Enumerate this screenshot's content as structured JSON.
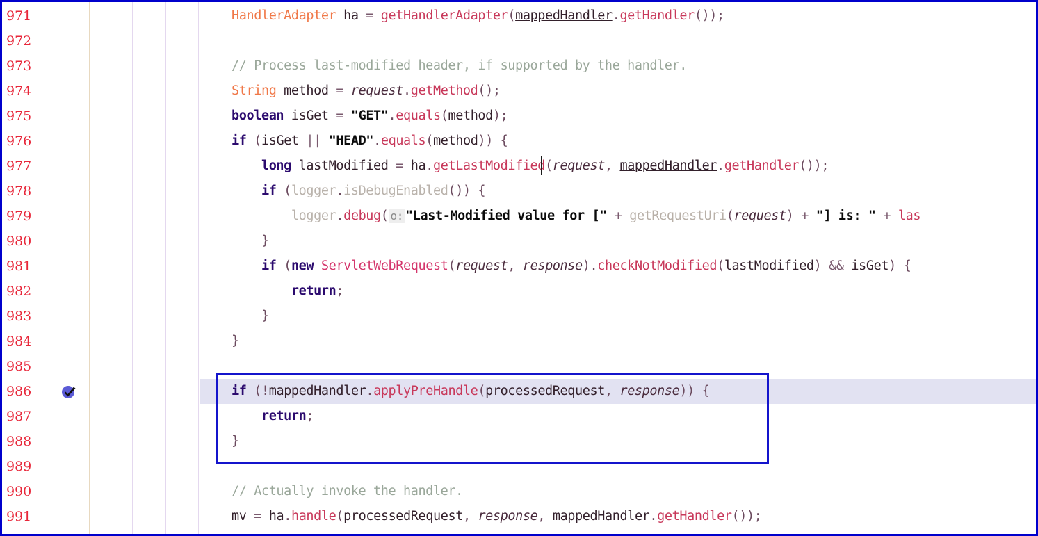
{
  "app": {
    "kind": "code-editor",
    "language": "java",
    "accent_color": "#1414cc",
    "linenumber_color": "#e8273a",
    "exec_highlight_color": "#e2e2f2"
  },
  "gutter": {
    "line_numbers": [
      "971",
      "972",
      "973",
      "974",
      "975",
      "976",
      "977",
      "978",
      "979",
      "980",
      "981",
      "982",
      "983",
      "984",
      "985",
      "986",
      "987",
      "988",
      "989",
      "990",
      "991"
    ],
    "breakpoint": {
      "icon": "breakpoint-verified-icon",
      "on_line": "986",
      "fill_color": "#5b5bd6",
      "check_color": "#111111"
    }
  },
  "selection": {
    "label": "code-selection-rectangle",
    "border_color": "#1414cc",
    "start_line": "986",
    "end_line": "988"
  },
  "caret": {
    "line": "977",
    "after_text": "getLastModifi"
  },
  "inline_hints": [
    {
      "line": "979",
      "text": "o:"
    }
  ],
  "code": {
    "lines": [
      {
        "num": "971",
        "tokens": [
          {
            "t": "type",
            "v": "HandlerAdapter"
          },
          {
            "t": "plain",
            "v": " ha "
          },
          {
            "t": "op",
            "v": "="
          },
          {
            "t": "plain",
            "v": " "
          },
          {
            "t": "mth",
            "v": "getHandlerAdapter"
          },
          {
            "t": "punc",
            "v": "("
          },
          {
            "t": "fld",
            "v": "mappedHandler"
          },
          {
            "t": "punc",
            "v": "."
          },
          {
            "t": "mth",
            "v": "getHandler"
          },
          {
            "t": "punc",
            "v": "());"
          }
        ]
      },
      {
        "num": "972",
        "tokens": []
      },
      {
        "num": "973",
        "tokens": [
          {
            "t": "cmt",
            "v": "// Process last-modified header, if supported by the handler."
          }
        ]
      },
      {
        "num": "974",
        "tokens": [
          {
            "t": "type",
            "v": "String"
          },
          {
            "t": "plain",
            "v": " method "
          },
          {
            "t": "op",
            "v": "="
          },
          {
            "t": "plain",
            "v": " "
          },
          {
            "t": "parm",
            "v": "request"
          },
          {
            "t": "punc",
            "v": "."
          },
          {
            "t": "mth",
            "v": "getMethod"
          },
          {
            "t": "punc",
            "v": "();"
          }
        ]
      },
      {
        "num": "975",
        "tokens": [
          {
            "t": "kw",
            "v": "boolean"
          },
          {
            "t": "plain",
            "v": " isGet "
          },
          {
            "t": "op",
            "v": "="
          },
          {
            "t": "plain",
            "v": " "
          },
          {
            "t": "str",
            "v": "\"GET\""
          },
          {
            "t": "punc",
            "v": "."
          },
          {
            "t": "mth",
            "v": "equals"
          },
          {
            "t": "punc",
            "v": "("
          },
          {
            "t": "plain",
            "v": "method"
          },
          {
            "t": "punc",
            "v": ");"
          }
        ]
      },
      {
        "num": "976",
        "tokens": [
          {
            "t": "kw",
            "v": "if"
          },
          {
            "t": "plain",
            "v": " "
          },
          {
            "t": "punc",
            "v": "("
          },
          {
            "t": "plain",
            "v": "isGet "
          },
          {
            "t": "op",
            "v": "||"
          },
          {
            "t": "plain",
            "v": " "
          },
          {
            "t": "str",
            "v": "\"HEAD\""
          },
          {
            "t": "punc",
            "v": "."
          },
          {
            "t": "mth",
            "v": "equals"
          },
          {
            "t": "punc",
            "v": "("
          },
          {
            "t": "plain",
            "v": "method"
          },
          {
            "t": "punc",
            "v": ")) {"
          }
        ]
      },
      {
        "num": "977",
        "indent": 1,
        "tokens": [
          {
            "t": "kw",
            "v": "long"
          },
          {
            "t": "plain",
            "v": " lastModified "
          },
          {
            "t": "op",
            "v": "="
          },
          {
            "t": "plain",
            "v": " ha"
          },
          {
            "t": "punc",
            "v": "."
          },
          {
            "t": "mth",
            "v": "getLastModified"
          },
          {
            "t": "punc",
            "v": "("
          },
          {
            "t": "parm",
            "v": "request"
          },
          {
            "t": "punc",
            "v": ", "
          },
          {
            "t": "fld",
            "v": "mappedHandler"
          },
          {
            "t": "punc",
            "v": "."
          },
          {
            "t": "mth",
            "v": "getHandler"
          },
          {
            "t": "punc",
            "v": "());"
          }
        ]
      },
      {
        "num": "978",
        "indent": 1,
        "tokens": [
          {
            "t": "kw",
            "v": "if"
          },
          {
            "t": "plain",
            "v": " "
          },
          {
            "t": "punc",
            "v": "("
          },
          {
            "t": "dim",
            "v": "logger"
          },
          {
            "t": "punc",
            "v": "."
          },
          {
            "t": "dim",
            "v": "isDebugEnabled"
          },
          {
            "t": "punc",
            "v": "()) {"
          }
        ]
      },
      {
        "num": "979",
        "indent": 2,
        "tokens": [
          {
            "t": "dim",
            "v": "logger"
          },
          {
            "t": "punc",
            "v": "."
          },
          {
            "t": "mth",
            "v": "debug"
          },
          {
            "t": "punc",
            "v": "("
          },
          {
            "t": "hint",
            "v": "o:"
          },
          {
            "t": "str",
            "v": "\"Last-Modified value for [\""
          },
          {
            "t": "plain",
            "v": " "
          },
          {
            "t": "op",
            "v": "+"
          },
          {
            "t": "plain",
            "v": " "
          },
          {
            "t": "mth-d",
            "v": "getRequestUri"
          },
          {
            "t": "punc",
            "v": "("
          },
          {
            "t": "parm",
            "v": "request"
          },
          {
            "t": "punc",
            "v": ")"
          },
          {
            "t": "plain",
            "v": " "
          },
          {
            "t": "op",
            "v": "+"
          },
          {
            "t": "plain",
            "v": " "
          },
          {
            "t": "str",
            "v": "\"] is: \""
          },
          {
            "t": "plain",
            "v": " "
          },
          {
            "t": "op",
            "v": "+"
          },
          {
            "t": "plain",
            "v": " "
          },
          {
            "t": "mth",
            "v": "las"
          }
        ]
      },
      {
        "num": "980",
        "indent": 1,
        "tokens": [
          {
            "t": "punc",
            "v": "}"
          }
        ]
      },
      {
        "num": "981",
        "indent": 1,
        "tokens": [
          {
            "t": "kw",
            "v": "if"
          },
          {
            "t": "plain",
            "v": " "
          },
          {
            "t": "punc",
            "v": "("
          },
          {
            "t": "kw",
            "v": "new"
          },
          {
            "t": "plain",
            "v": " "
          },
          {
            "t": "cls",
            "v": "ServletWebRequest"
          },
          {
            "t": "punc",
            "v": "("
          },
          {
            "t": "parm",
            "v": "request"
          },
          {
            "t": "punc",
            "v": ", "
          },
          {
            "t": "parm",
            "v": "response"
          },
          {
            "t": "punc",
            "v": ")."
          },
          {
            "t": "mth",
            "v": "checkNotModified"
          },
          {
            "t": "punc",
            "v": "("
          },
          {
            "t": "plain",
            "v": "lastModified"
          },
          {
            "t": "punc",
            "v": ")"
          },
          {
            "t": "plain",
            "v": " "
          },
          {
            "t": "op",
            "v": "&&"
          },
          {
            "t": "plain",
            "v": " isGet"
          },
          {
            "t": "punc",
            "v": ") {"
          }
        ]
      },
      {
        "num": "982",
        "indent": 2,
        "tokens": [
          {
            "t": "kw",
            "v": "return"
          },
          {
            "t": "punc",
            "v": ";"
          }
        ]
      },
      {
        "num": "983",
        "indent": 1,
        "tokens": [
          {
            "t": "punc",
            "v": "}"
          }
        ]
      },
      {
        "num": "984",
        "tokens": [
          {
            "t": "punc",
            "v": "}"
          }
        ]
      },
      {
        "num": "985",
        "tokens": []
      },
      {
        "num": "986",
        "tokens": [
          {
            "t": "kw",
            "v": "if"
          },
          {
            "t": "plain",
            "v": " "
          },
          {
            "t": "punc",
            "v": "(!"
          },
          {
            "t": "fld",
            "v": "mappedHandler"
          },
          {
            "t": "punc",
            "v": "."
          },
          {
            "t": "mth",
            "v": "applyPreHandle"
          },
          {
            "t": "punc",
            "v": "("
          },
          {
            "t": "parm-u",
            "v": "processedRequest"
          },
          {
            "t": "punc",
            "v": ", "
          },
          {
            "t": "parm",
            "v": "response"
          },
          {
            "t": "punc",
            "v": ")) {"
          }
        ]
      },
      {
        "num": "987",
        "indent": 1,
        "tokens": [
          {
            "t": "kw",
            "v": "return"
          },
          {
            "t": "punc",
            "v": ";"
          }
        ]
      },
      {
        "num": "988",
        "tokens": [
          {
            "t": "punc",
            "v": "}"
          }
        ]
      },
      {
        "num": "989",
        "tokens": []
      },
      {
        "num": "990",
        "tokens": [
          {
            "t": "cmt",
            "v": "// Actually invoke the handler."
          }
        ]
      },
      {
        "num": "991",
        "tokens": [
          {
            "t": "fld",
            "v": "mv"
          },
          {
            "t": "plain",
            "v": " "
          },
          {
            "t": "op",
            "v": "="
          },
          {
            "t": "plain",
            "v": " ha"
          },
          {
            "t": "punc",
            "v": "."
          },
          {
            "t": "mth",
            "v": "handle"
          },
          {
            "t": "punc",
            "v": "("
          },
          {
            "t": "parm-u",
            "v": "processedRequest"
          },
          {
            "t": "punc",
            "v": ", "
          },
          {
            "t": "parm",
            "v": "response"
          },
          {
            "t": "punc",
            "v": ", "
          },
          {
            "t": "fld",
            "v": "mappedHandler"
          },
          {
            "t": "punc",
            "v": "."
          },
          {
            "t": "mth",
            "v": "getHandler"
          },
          {
            "t": "punc",
            "v": "());"
          }
        ]
      }
    ]
  }
}
